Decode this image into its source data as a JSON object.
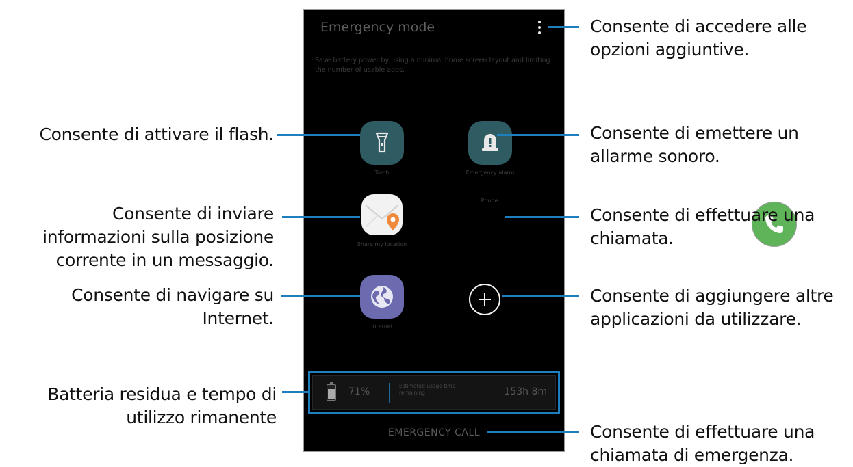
{
  "phone": {
    "title": "Emergency mode",
    "description": "Save battery power by using a minimal home screen layout and limiting the number of usable apps.",
    "apps": {
      "torch": "Torch",
      "alarm": "Emergency alarm",
      "share_location": "Share my location",
      "phone": "Phone",
      "internet": "Internet"
    },
    "battery": {
      "percent": "71%",
      "estimated_label": "Estimated usage time remaining",
      "time": "153h 8m"
    },
    "emergency_call": "EMERGENCY CALL"
  },
  "annotations": {
    "options": "Consente di accedere alle opzioni aggiuntive.",
    "flash": "Consente di attivare il flash.",
    "alarm": "Consente di emettere un allarme sonoro.",
    "location": "Consente di inviare informazioni sulla posizione corrente in un messaggio.",
    "call": "Consente di effettuare una chiamata.",
    "internet": "Consente di navigare su Internet.",
    "add": "Consente di aggiungere altre applicazioni da utilizzare.",
    "battery": "Batteria residua e tempo di utilizzo rimanente",
    "emergency": "Consente di effettuare una chiamata di emergenza."
  },
  "colors": {
    "leader_line": "#1e7fbf",
    "screen_bg": "#000000",
    "torch_alarm_icon": "#2f5b63",
    "phone_icon": "#5fb45a",
    "internet_icon": "#6c6bb0"
  }
}
